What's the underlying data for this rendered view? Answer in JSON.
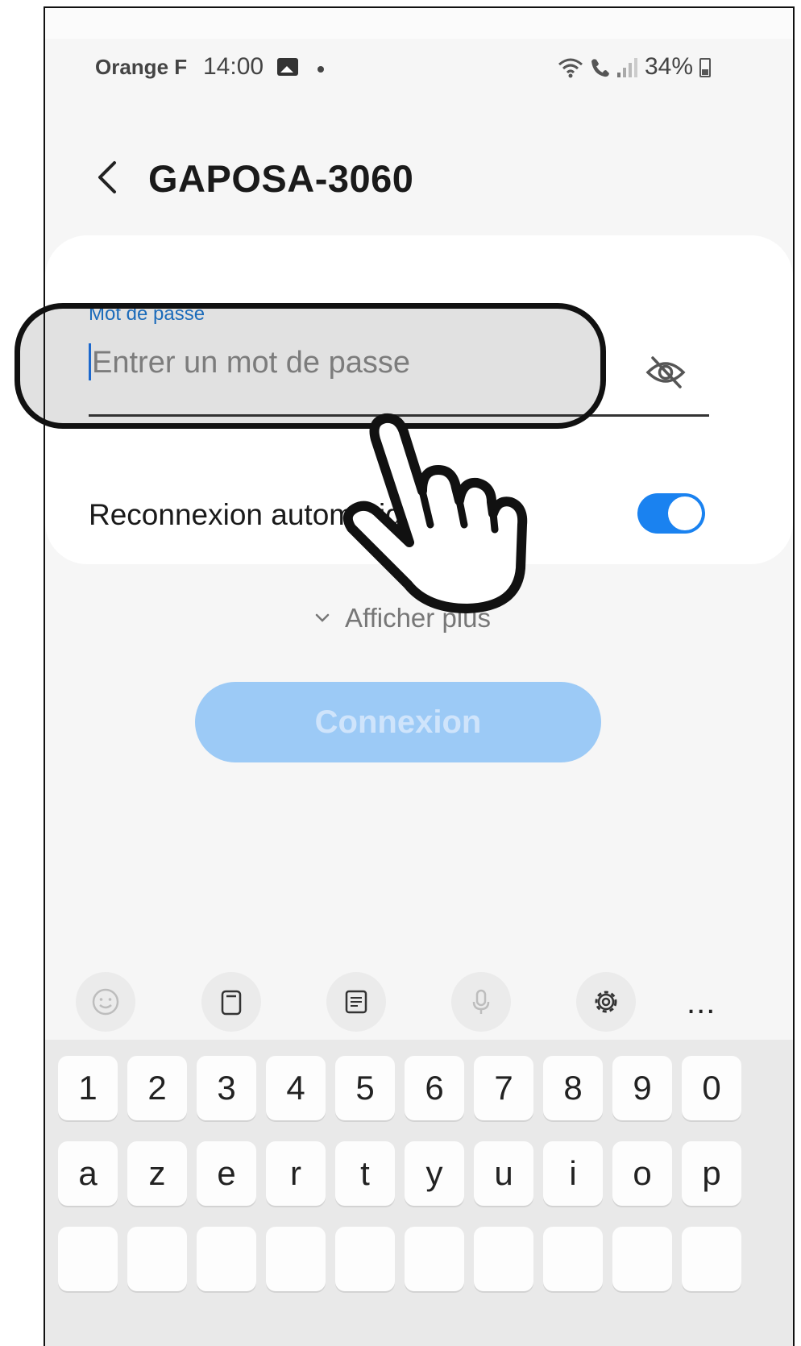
{
  "status_bar": {
    "carrier": "Orange F",
    "time": "14:00",
    "battery": "34%",
    "icons": [
      "gallery-icon",
      "dot-icon",
      "wifi-icon",
      "call-icon",
      "signal-icon",
      "battery-icon"
    ]
  },
  "header": {
    "title": "GAPOSA-3060",
    "back_icon": "chevron-left-icon"
  },
  "form": {
    "password_label": "Mot de passe",
    "password_placeholder": "Entrer un mot de passe",
    "password_value": "",
    "visibility_icon": "eye-off-icon",
    "auto_reconnect_label": "Reconnexion automatique",
    "auto_reconnect_on": true
  },
  "show_more_label": "Afficher plus",
  "connect_label": "Connexion",
  "keyboard": {
    "toolbar": [
      "emoji-icon",
      "clipboard-icon",
      "text-mode-icon",
      "mic-icon",
      "settings-icon",
      "more-icon"
    ],
    "more_label": "...",
    "number_row": [
      "1",
      "2",
      "3",
      "4",
      "5",
      "6",
      "7",
      "8",
      "9",
      "0"
    ],
    "letter_row_1": [
      "a",
      "z",
      "e",
      "r",
      "t",
      "y",
      "u",
      "i",
      "o",
      "p"
    ]
  },
  "overlay": {
    "highlight_color": "#111111",
    "pointer_icon": "pointing-hand-icon"
  },
  "colors": {
    "accent": "#1a82f0",
    "label": "#1976d2",
    "connect_disabled": "#9ccaf6"
  }
}
